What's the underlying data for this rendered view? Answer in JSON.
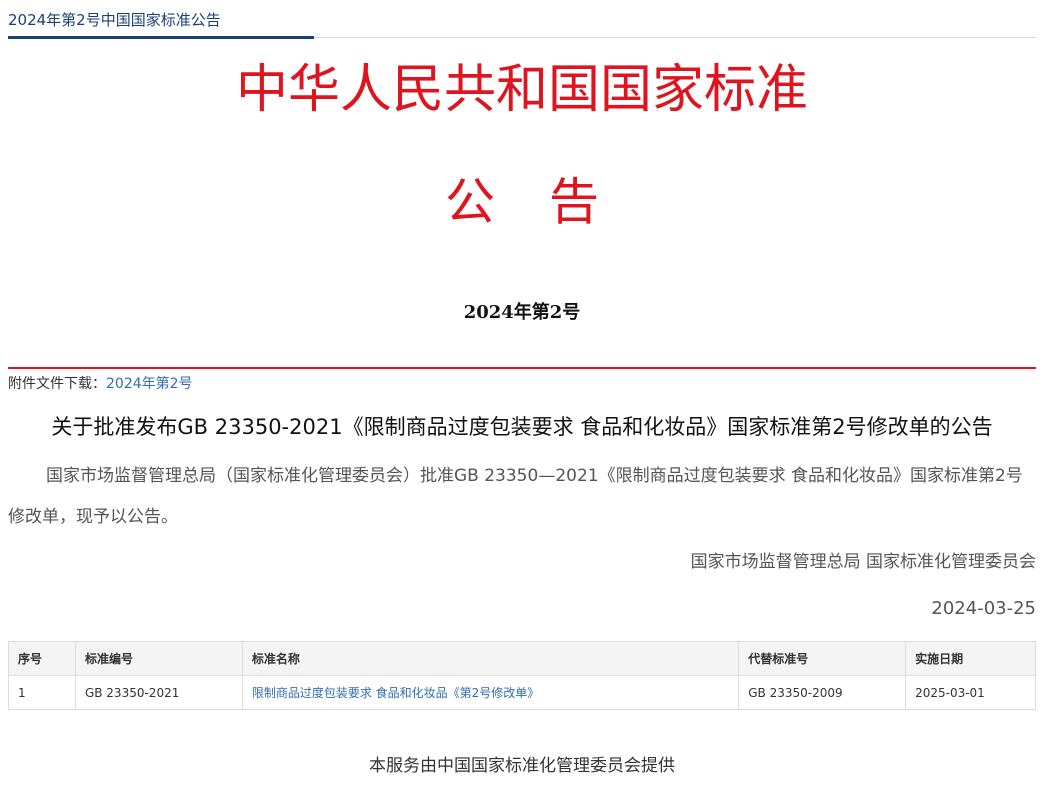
{
  "breadcrumb": "2024年第2号中国国家标准公告",
  "header": {
    "org_name": "中华人民共和国国家标准",
    "doc_type": "公告",
    "doc_number": "2024年第2号"
  },
  "attachment": {
    "label": "附件文件下载：",
    "link": "2024年第2号"
  },
  "announcement": {
    "title": "关于批准发布GB 23350-2021《限制商品过度包装要求 食品和化妆品》国家标准第2号修改单的公告",
    "body": "国家市场监督管理总局（国家标准化管理委员会）批准GB 23350—2021《限制商品过度包装要求 食品和化妆品》国家标准第2号修改单，现予以公告。",
    "signer": "国家市场监督管理总局 国家标准化管理委员会",
    "date": "2024-03-25"
  },
  "table": {
    "headers": [
      "序号",
      "标准编号",
      "标准名称",
      "代替标准号",
      "实施日期"
    ],
    "rows": [
      [
        "1",
        "GB 23350-2021",
        "限制商品过度包装要求 食品和化妆品《第2号修改单》",
        "GB 23350-2009",
        "2025-03-01"
      ]
    ]
  },
  "footer": "本服务由中国国家标准化管理委员会提供",
  "colors": {
    "title_red": "#e0141e",
    "nav_blue": "#1a3f7a",
    "link_blue": "#2f6fb1"
  }
}
